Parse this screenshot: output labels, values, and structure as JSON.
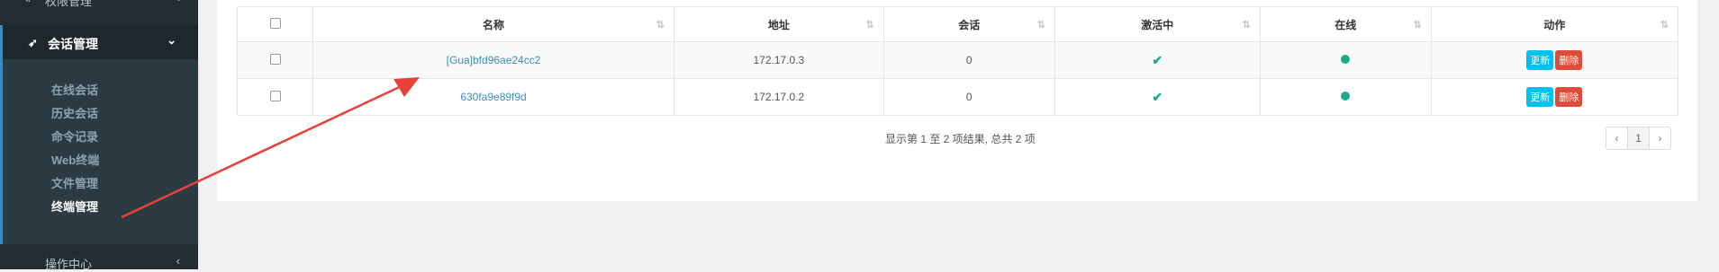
{
  "sidebar": {
    "top_label": "权限管理",
    "menu_label": "会话管理",
    "items": [
      {
        "label": "在线会话"
      },
      {
        "label": "历史会话"
      },
      {
        "label": "命令记录"
      },
      {
        "label": "Web终端"
      },
      {
        "label": "文件管理"
      },
      {
        "label": "终端管理"
      }
    ],
    "bottom_label": "操作中心"
  },
  "table": {
    "headers": [
      "名称",
      "地址",
      "会话",
      "激活中",
      "在线",
      "动作"
    ],
    "rows": [
      {
        "name": "[Gua]bfd96ae24cc2",
        "address": "172.17.0.3",
        "sessions": "0",
        "active": true,
        "online": true
      },
      {
        "name": "630fa9e89f9d",
        "address": "172.17.0.2",
        "sessions": "0",
        "active": true,
        "online": true
      }
    ],
    "update_label": "更新",
    "delete_label": "删除"
  },
  "summary": "显示第 1 至 2 项结果, 总共 2 项",
  "pager": {
    "prev": "‹",
    "page": "1",
    "next": "›"
  },
  "colors": {
    "sidebar_bg": "#222d32",
    "accent": "#3c8dbc",
    "success": "#1aab8a",
    "danger": "#dd4b39",
    "info": "#00c0ef",
    "annotation": "#e8413a"
  }
}
